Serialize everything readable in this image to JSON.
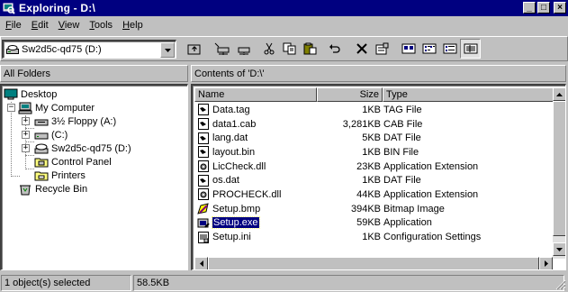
{
  "window": {
    "title": "Exploring - D:\\",
    "minimize_glyph": "_",
    "maximize_glyph": "□",
    "close_glyph": "×"
  },
  "menu": [
    {
      "accel": "F",
      "rest": "ile"
    },
    {
      "accel": "E",
      "rest": "dit"
    },
    {
      "accel": "V",
      "rest": "iew"
    },
    {
      "accel": "T",
      "rest": "ools"
    },
    {
      "accel": "H",
      "rest": "elp"
    }
  ],
  "toolbar": {
    "drive_selector": "Sw2d5c-qd75 (D:)",
    "buttons": [
      "up-one-level",
      "map-network-drive",
      "disconnect-drive",
      "cut",
      "copy",
      "paste",
      "undo",
      "delete",
      "properties",
      "large-icons",
      "small-icons",
      "list",
      "details"
    ],
    "pressed": "details"
  },
  "left_pane": {
    "header": "All Folders",
    "tree": [
      {
        "label": "Desktop",
        "icon": "desktop-icon"
      },
      {
        "label": "My Computer",
        "icon": "computer-icon",
        "expander": "−"
      },
      {
        "label": "3½ Floppy (A:)",
        "icon": "floppy-icon",
        "expander": "+"
      },
      {
        "label": "(C:)",
        "icon": "harddisk-icon",
        "expander": "+"
      },
      {
        "label": "Sw2d5c-qd75 (D:)",
        "icon": "cdrom-icon",
        "expander": "+"
      },
      {
        "label": "Control Panel",
        "icon": "control-panel-icon"
      },
      {
        "label": "Printers",
        "icon": "printers-icon"
      },
      {
        "label": "Recycle Bin",
        "icon": "recycle-bin-icon"
      }
    ]
  },
  "right_pane": {
    "header": "Contents of 'D:\\'",
    "columns": {
      "name": "Name",
      "size": "Size",
      "type": "Type"
    },
    "files": [
      {
        "name": "Data.tag",
        "size": "1KB",
        "type": "TAG File",
        "icon": "file-icon"
      },
      {
        "name": "data1.cab",
        "size": "3,281KB",
        "type": "CAB File",
        "icon": "file-icon"
      },
      {
        "name": "lang.dat",
        "size": "5KB",
        "type": "DAT File",
        "icon": "file-icon"
      },
      {
        "name": "layout.bin",
        "size": "1KB",
        "type": "BIN File",
        "icon": "file-icon"
      },
      {
        "name": "LicCheck.dll",
        "size": "23KB",
        "type": "Application Extension",
        "icon": "dll-icon"
      },
      {
        "name": "os.dat",
        "size": "1KB",
        "type": "DAT File",
        "icon": "file-icon"
      },
      {
        "name": "PROCHECK.dll",
        "size": "44KB",
        "type": "Application Extension",
        "icon": "dll-icon"
      },
      {
        "name": "Setup.bmp",
        "size": "394KB",
        "type": "Bitmap Image",
        "icon": "bitmap-icon"
      },
      {
        "name": "Setup.exe",
        "size": "59KB",
        "type": "Application",
        "icon": "setup-exe-icon",
        "selected": true
      },
      {
        "name": "Setup.ini",
        "size": "1KB",
        "type": "Configuration Settings",
        "icon": "ini-icon"
      }
    ]
  },
  "status": {
    "selection": "1 object(s) selected",
    "size": "58.5KB"
  },
  "colors": {
    "titlebar": "#000080",
    "face": "#c0c0c0",
    "selection": "#000080"
  }
}
